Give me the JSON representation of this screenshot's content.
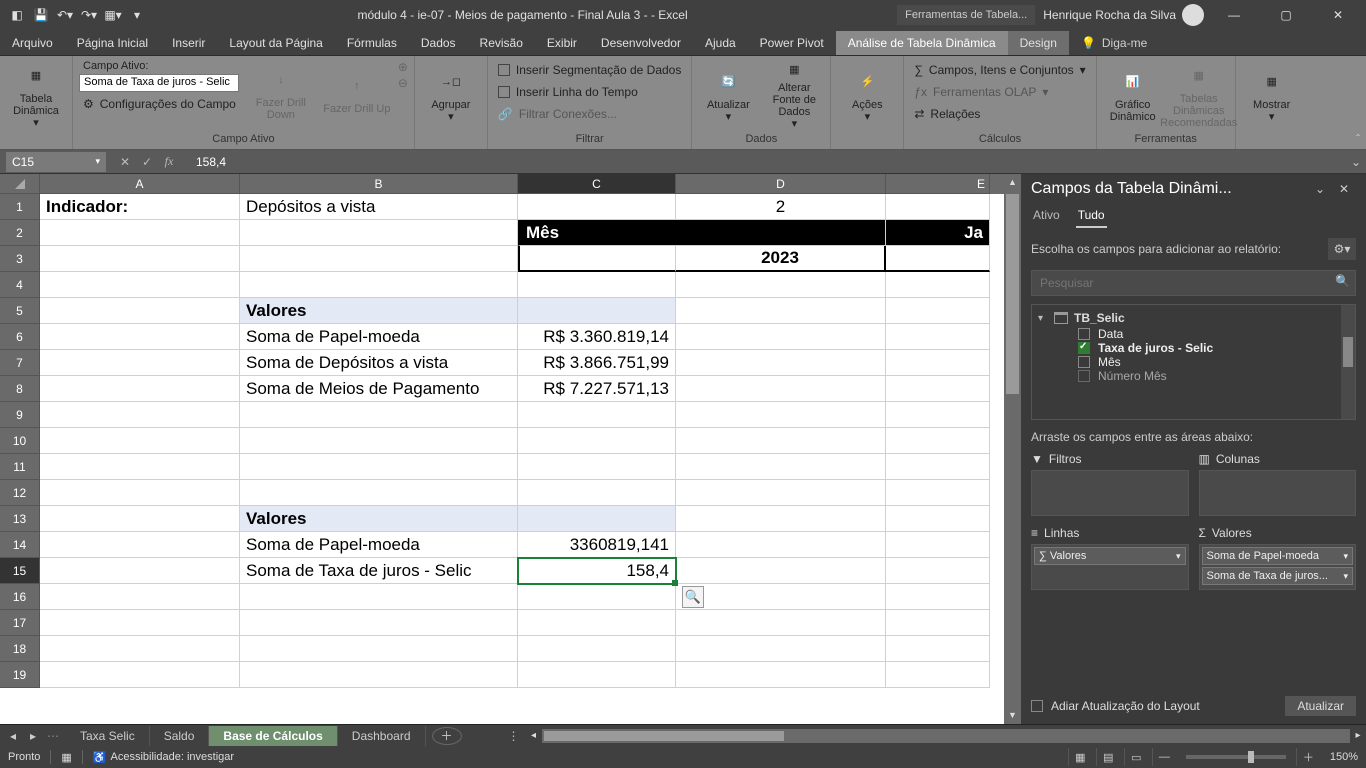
{
  "titlebar": {
    "title": "módulo 4 - ie-07 - Meios de pagamento - Final Aula 3 -  -  Excel",
    "context_tab": "Ferramentas de Tabela...",
    "user": "Henrique Rocha da Silva"
  },
  "tabs": {
    "arquivo": "Arquivo",
    "pagina": "Página Inicial",
    "inserir": "Inserir",
    "layout": "Layout da Página",
    "formulas": "Fórmulas",
    "dados": "Dados",
    "revisao": "Revisão",
    "exibir": "Exibir",
    "desenvolvedor": "Desenvolvedor",
    "ajuda": "Ajuda",
    "powerpivot": "Power Pivot",
    "analise": "Análise de Tabela Dinâmica",
    "design": "Design",
    "digame": "Diga-me"
  },
  "ribbon": {
    "group1": {
      "label": "",
      "btn": "Tabela Dinâmica"
    },
    "group2": {
      "label": "Campo Ativo",
      "caption": "Campo Ativo:",
      "value": "Soma de Taxa de juros - Selic",
      "config": "Configurações do Campo",
      "drilldown": "Fazer Drill Down",
      "drillup": "Fazer Drill Up"
    },
    "group3": {
      "agrupar": "Agrupar"
    },
    "group4": {
      "label": "Filtrar",
      "seg": "Inserir Segmentação de Dados",
      "linha": "Inserir Linha do Tempo",
      "conexoes": "Filtrar Conexões..."
    },
    "group5": {
      "label": "Dados",
      "atualizar": "Atualizar",
      "alterar": "Alterar Fonte de Dados"
    },
    "group6": {
      "label": "",
      "acoes": "Ações"
    },
    "group7": {
      "label": "Cálculos",
      "campos": "Campos, Itens e Conjuntos",
      "olap": "Ferramentas OLAP",
      "rel": "Relações"
    },
    "group8": {
      "label": "Ferramentas",
      "grafico": "Gráfico Dinâmico",
      "tabelas": "Tabelas Dinâmicas Recomendadas"
    },
    "group9": {
      "label": "",
      "mostrar": "Mostrar"
    }
  },
  "formulabar": {
    "name": "C15",
    "value": "158,4"
  },
  "cols": {
    "A": "A",
    "B": "B",
    "C": "C",
    "D": "D",
    "E": "E"
  },
  "cells": {
    "A1": "Indicador:",
    "B1": "Depósitos a vista",
    "D1": "2",
    "C2": "Mês",
    "E2": "Ja",
    "D3": "2023",
    "B5": "Valores",
    "B6": "Soma de Papel-moeda",
    "C6": "R$ 3.360.819,14",
    "B7": "Soma de Depósitos a vista",
    "C7": "R$ 3.866.751,99",
    "B8": "Soma de Meios de Pagamento",
    "C8": "R$ 7.227.571,13",
    "B13": "Valores",
    "B14": "Soma de Papel-moeda",
    "C14": "3360819,141",
    "B15": "Soma de Taxa de juros - Selic",
    "C15": "158,4"
  },
  "pivot": {
    "title": "Campos da Tabela Dinâmi...",
    "tab_ativo": "Ativo",
    "tab_tudo": "Tudo",
    "instr": "Escolha os campos para adicionar ao relatório:",
    "search_ph": "Pesquisar",
    "table": "TB_Selic",
    "f_data": "Data",
    "f_taxa": "Taxa de juros - Selic",
    "f_mes": "Mês",
    "f_num": "Número Mês",
    "areas_instr": "Arraste os campos entre as áreas abaixo:",
    "a_filtros": "Filtros",
    "a_colunas": "Colunas",
    "a_linhas": "Linhas",
    "a_valores": "Valores",
    "chip_valores": "∑  Valores",
    "chip_papel": "Soma de Papel-moeda",
    "chip_taxa": "Soma de Taxa de juros...",
    "defer": "Adiar Atualização do Layout",
    "update": "Atualizar"
  },
  "sheets": {
    "taxa": "Taxa Selic",
    "saldo": "Saldo",
    "base": "Base de Cálculos",
    "dash": "Dashboard"
  },
  "status": {
    "ready": "Pronto",
    "acc": "Acessibilidade: investigar",
    "zoom": "150%"
  }
}
